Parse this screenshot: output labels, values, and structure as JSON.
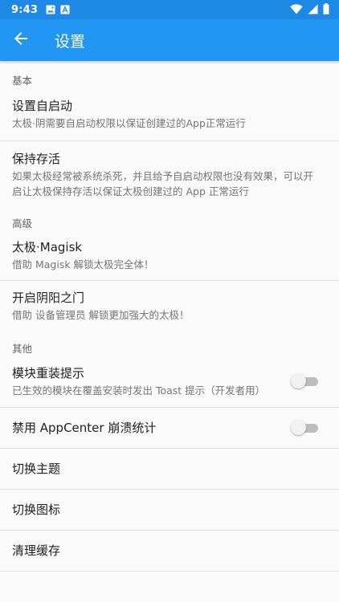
{
  "status_bar": {
    "time": "9:43",
    "left_icons": [
      "image-icon",
      "font-icon"
    ],
    "right_icons": [
      "wifi-icon",
      "signal-icon",
      "battery-icon"
    ]
  },
  "app_bar": {
    "title": "设置",
    "back_icon": "arrow-back-icon",
    "color": "#2196f3"
  },
  "sections": {
    "basic": {
      "header": "基本",
      "items": [
        {
          "title": "设置自启动",
          "summary": "太极·阴需要自启动权限以保证创建过的App正常运行"
        },
        {
          "title": "保持存活",
          "summary": "如果太极经常被系统杀死，并且给予自启动权限也没有效果，可以开启让太极保持存活以保证太极创建过的 App 正常运行"
        }
      ]
    },
    "advanced": {
      "header": "高级",
      "items": [
        {
          "title": "太极·Magisk",
          "summary": "借助 Magisk 解锁太极完全体！"
        },
        {
          "title": "开启阴阳之门",
          "summary": "借助 设备管理员 解锁更加强大的太极！"
        }
      ]
    },
    "other": {
      "header": "其他",
      "items": [
        {
          "title": "模块重装提示",
          "summary": "已生效的模块在覆盖安装时发出 Toast 提示（开发者用）",
          "switch": false
        },
        {
          "title": "禁用 AppCenter 崩溃统计",
          "switch": false
        },
        {
          "title": "切换主题"
        },
        {
          "title": "切换图标"
        },
        {
          "title": "清理缓存"
        }
      ]
    }
  }
}
